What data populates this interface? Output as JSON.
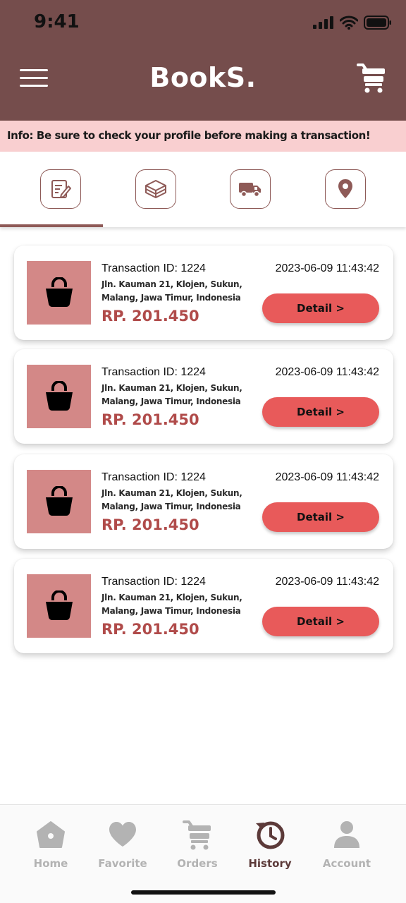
{
  "status_bar": {
    "time": "9:41"
  },
  "header": {
    "title": "BookS."
  },
  "info_banner": {
    "text": "Info: Be sure to check your profile before making a transaction!"
  },
  "order_status_tabs": [
    {
      "icon": "edit-note-icon"
    },
    {
      "icon": "package-box-icon"
    },
    {
      "icon": "delivery-truck-icon"
    },
    {
      "icon": "location-pin-icon"
    }
  ],
  "transactions": [
    {
      "id_label": "Transaction ID: 1224",
      "datetime": "2023-06-09 11:43:42",
      "address": "Jln. Kauman 21, Klojen, Sukun, Malang, Jawa Timur, Indonesia",
      "price": "RP. 201.450",
      "detail_label": "Detail >",
      "icon": "shopping-bag-icon"
    },
    {
      "id_label": "Transaction ID: 1224",
      "datetime": "2023-06-09 11:43:42",
      "address": "Jln. Kauman 21, Klojen, Sukun, Malang, Jawa Timur, Indonesia",
      "price": "RP. 201.450",
      "detail_label": "Detail >",
      "icon": "shopping-bag-icon"
    },
    {
      "id_label": "Transaction ID: 1224",
      "datetime": "2023-06-09 11:43:42",
      "address": "Jln. Kauman 21, Klojen, Sukun, Malang, Jawa Timur, Indonesia",
      "price": "RP. 201.450",
      "detail_label": "Detail >",
      "icon": "shopping-bag-icon"
    },
    {
      "id_label": "Transaction ID: 1224",
      "datetime": "2023-06-09 11:43:42",
      "address": "Jln. Kauman 21, Klojen, Sukun, Malang, Jawa Timur, Indonesia",
      "price": "RP. 201.450",
      "detail_label": "Detail >",
      "icon": "shopping-bag-icon"
    }
  ],
  "bottom_nav": [
    {
      "label": "Home",
      "icon": "home-icon",
      "active": false
    },
    {
      "label": "Favorite",
      "icon": "heart-icon",
      "active": false
    },
    {
      "label": "Orders",
      "icon": "cart-icon",
      "active": false
    },
    {
      "label": "History",
      "icon": "history-icon",
      "active": true
    },
    {
      "label": "Account",
      "icon": "person-icon",
      "active": false
    }
  ],
  "colors": {
    "header": "#754d4c",
    "banner": "#f9cfd0",
    "accent": "#e85a5a",
    "price": "#b04b4a",
    "thumb": "#d38887",
    "active_nav": "#5c3a39",
    "inactive_nav": "#b3b3b3"
  }
}
